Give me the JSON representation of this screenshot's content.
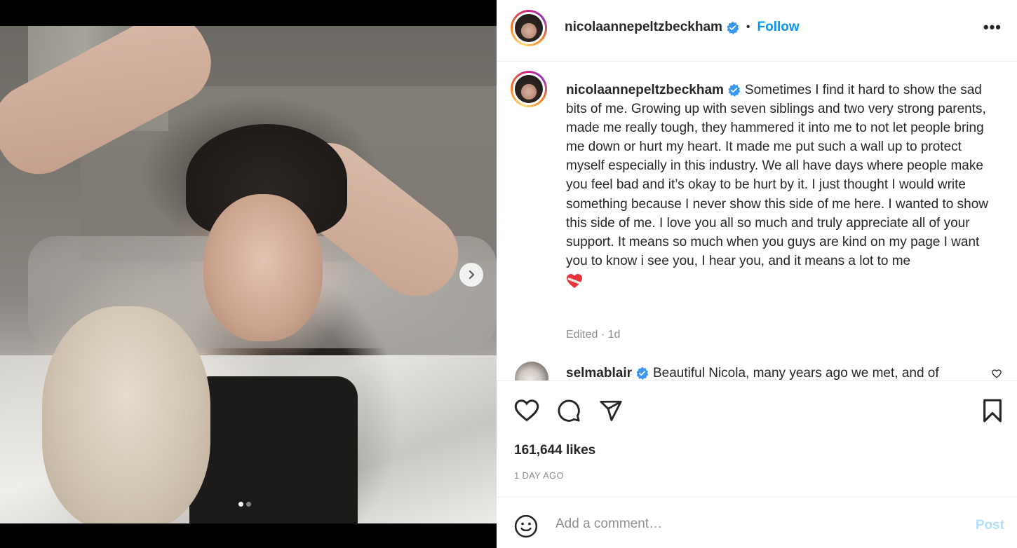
{
  "post": {
    "image_alt": "Photo of woman in bed with teddy bear",
    "carousel": {
      "total": 2,
      "current": 1
    }
  },
  "header": {
    "username": "nicolaannepeltzbeckham",
    "separator": "•",
    "follow_label": "Follow",
    "more_label": "•••"
  },
  "caption": {
    "username": "nicolaannepeltzbeckham",
    "text": "Sometimes I find it hard to show the sad bits of me. Growing up with seven siblings and two very strong parents, made me really tough, they hammered it into me to not let people bring me down or hurt my heart. It made me put such a wall up to protect myself especially in this industry. We all have days where people make you feel bad and it’s okay to be hurt by it. I just thought I would write something because I never show this side of me here. I wanted to show this side of me. I love you all so much and truly appreciate all of your support. It means so much when you guys are kind on my page I want you to know i see you, I hear you, and it means a lot to me",
    "emoji": "❤️‍🩹",
    "edited": "Edited · 1d"
  },
  "comments": [
    {
      "username": "selmablair",
      "text": "Beautiful Nicola, many years ago we met, and of"
    }
  ],
  "engagement": {
    "likes": "161,644 likes",
    "time": "1 DAY AGO"
  },
  "composer": {
    "placeholder": "Add a comment…",
    "post_label": "Post"
  },
  "colors": {
    "accent": "#0095f6",
    "post_disabled": "#b2dffc",
    "muted": "#8e8e8e",
    "verified": "#3897f0"
  }
}
